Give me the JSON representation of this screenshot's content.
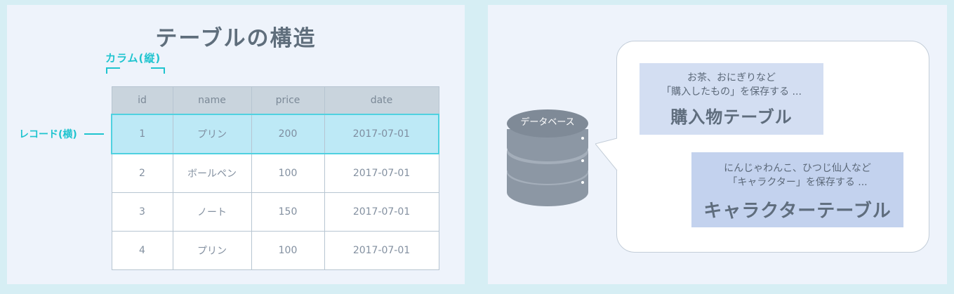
{
  "left": {
    "title": "テーブルの構造",
    "column_label": "カラム(縦)",
    "record_label": "レコード(横)",
    "table": {
      "headers": [
        "id",
        "name",
        "price",
        "date"
      ],
      "rows": [
        [
          "1",
          "プリン",
          "200",
          "2017-07-01"
        ],
        [
          "2",
          "ボールペン",
          "100",
          "2017-07-01"
        ],
        [
          "3",
          "ノート",
          "150",
          "2017-07-01"
        ],
        [
          "4",
          "プリン",
          "100",
          "2017-07-01"
        ]
      ],
      "highlighted_row": 0
    }
  },
  "right": {
    "database_label": "データベース",
    "purchase_table": {
      "line1": "お茶、おにぎりなど",
      "line2": "「購入したもの」を保存する ...",
      "name": "購入物テーブル"
    },
    "character_table": {
      "line1": "にんじゃわんこ、ひつじ仙人など",
      "line2": "「キャラクター」を保存する ...",
      "name": "キャラクターテーブル"
    }
  },
  "colors": {
    "accent": "#1fc4cf",
    "highlight_row": "#bde9f6",
    "header_bg": "#c9d4dd",
    "card1_bg": "#d3def2",
    "card2_bg": "#c3d2ee",
    "database_icon": "#8c97a4"
  }
}
